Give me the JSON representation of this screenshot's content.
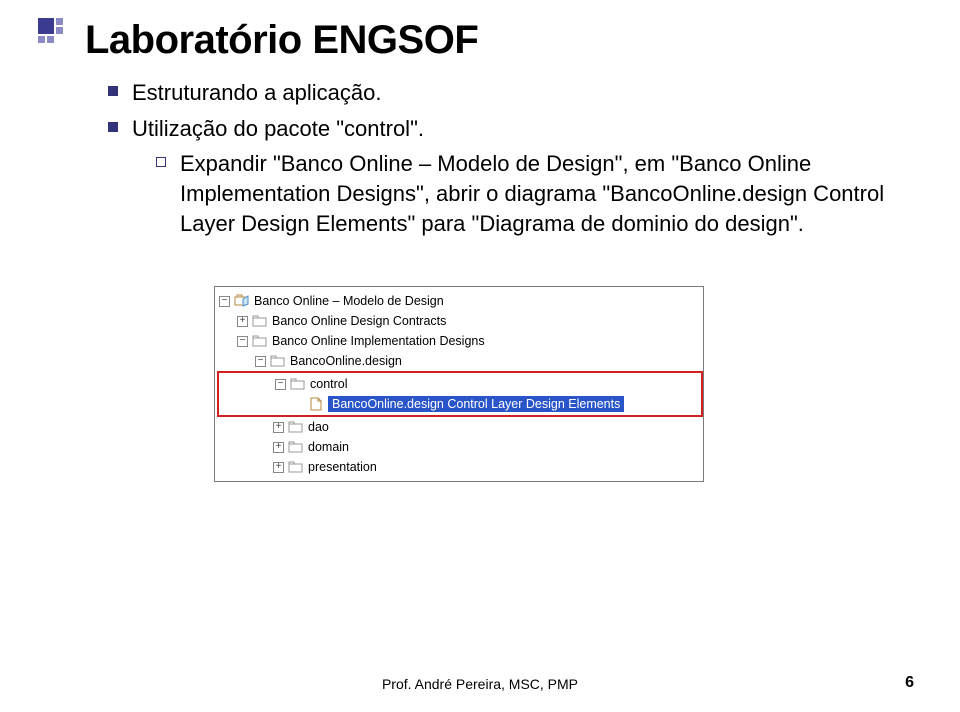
{
  "title": "Laboratório ENGSOF",
  "bullets": [
    "Estruturando a aplicação.",
    "Utilização do pacote \"control\"."
  ],
  "sub_bullet": "Expandir \"Banco Online – Modelo de Design\", em \"Banco Online Implementation Designs\", abrir o diagrama \"BancoOnline.design Control Layer Design Elements\" para \"Diagrama de dominio do design\".",
  "tree": {
    "root": "Banco Online – Modelo de Design",
    "contracts": "Banco Online Design Contracts",
    "impl": "Banco Online Implementation Designs",
    "design": "BancoOnline.design",
    "control": "control",
    "control_elem": "BancoOnline.design Control Layer Design Elements",
    "dao": "dao",
    "domain": "domain",
    "presentation": "presentation"
  },
  "footer": "Prof. André Pereira, MSC, PMP",
  "page": "6"
}
